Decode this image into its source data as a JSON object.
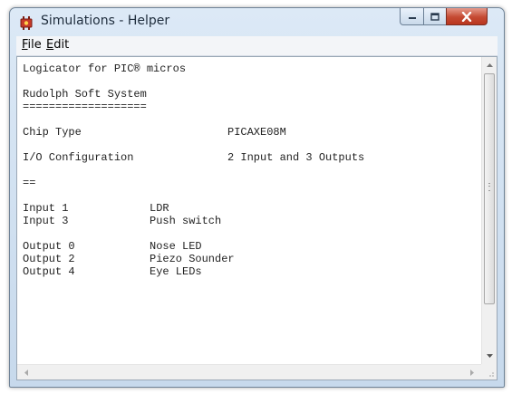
{
  "window": {
    "title": "Simulations - Helper"
  },
  "menu": {
    "file": {
      "accel": "F",
      "rest": "ile"
    },
    "edit": {
      "accel": "E",
      "rest": "dit"
    }
  },
  "document": {
    "line1": "Logicator for PIC® micros",
    "line2": "Rudolph Soft System",
    "line3": "===================",
    "chip_type": {
      "label": "Chip Type",
      "value": "PICAXE08M"
    },
    "io_config": {
      "label": "I/O Configuration",
      "value": "2 Input and 3 Outputs"
    },
    "separator": "==",
    "inputs": [
      {
        "label": "Input 1",
        "value": "LDR"
      },
      {
        "label": "Input 3",
        "value": "Push switch"
      }
    ],
    "outputs": [
      {
        "label": "Output 0",
        "value": "Nose LED"
      },
      {
        "label": "Output 2",
        "value": "Piezo Sounder"
      },
      {
        "label": "Output 4",
        "value": "Eye LEDs"
      }
    ]
  },
  "colors": {
    "titlebar": "#c7d9ec",
    "close_button": "#c54a32",
    "text": "#222222"
  }
}
